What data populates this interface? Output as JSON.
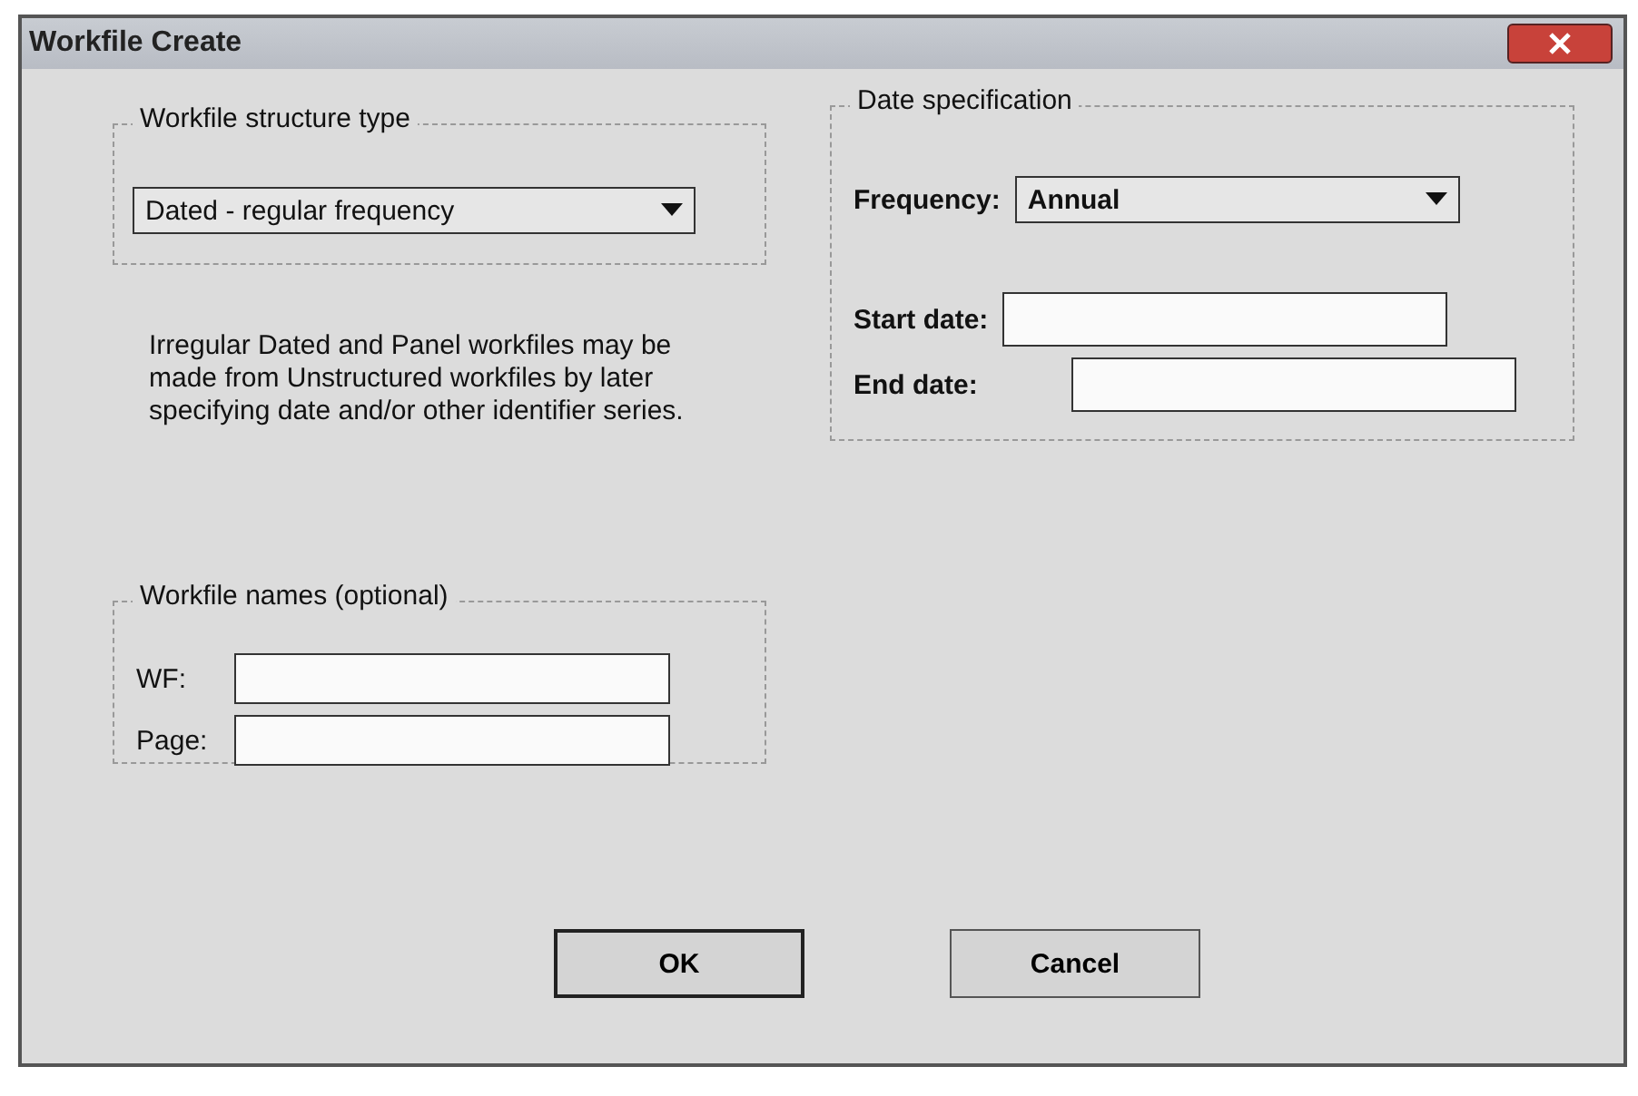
{
  "window": {
    "title": "Workfile Create"
  },
  "structure": {
    "title": "Workfile structure type",
    "value": "Dated - regular frequency"
  },
  "note": "Irregular Dated and Panel workfiles may be made from Unstructured workfiles by later specifying date and/or other identifier series.",
  "date_spec": {
    "title": "Date specification",
    "frequency_label": "Frequency:",
    "frequency_value": "Annual",
    "fields": [
      {
        "label": "Start date:"
      },
      {
        "label": "End date:"
      }
    ]
  },
  "names": {
    "title": "Workfile names (optional)",
    "fields": [
      {
        "label": "WF:"
      },
      {
        "label": "Page:"
      }
    ]
  },
  "buttons": [
    {
      "label": "OK",
      "default": true
    },
    {
      "label": "Cancel",
      "default": false
    }
  ]
}
